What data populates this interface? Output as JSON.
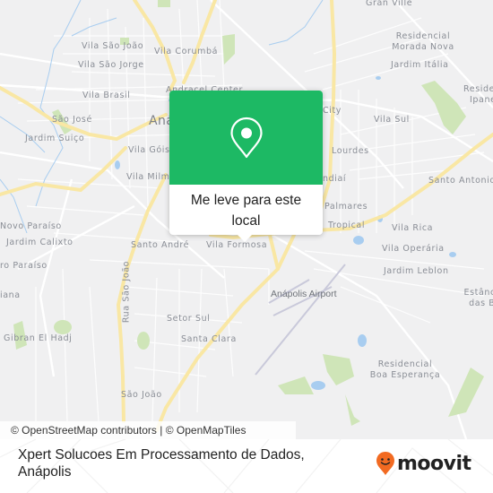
{
  "map": {
    "labels": {
      "gran_ville": "Gran Ville",
      "vila_sao_joao": "Vila São João",
      "vila_corumba": "Vila Corumbá",
      "vila_sao_jorge": "Vila São Jorge",
      "residencial_morada_nova_1": "Residencial",
      "residencial_morada_nova_2": "Morada Nova",
      "jardim_italia": "Jardim Itália",
      "residencial_ipanema_1": "Reside",
      "residencial_ipanema_2": "Ipane",
      "vila_brasil": "Vila Brasil",
      "andracel_center": "Andracel Center",
      "city": "City",
      "vila_sul": "Vila Sul",
      "sao_jose": "São José",
      "anapolis": "Aná",
      "jardim_suico": "Jardim Suiço",
      "vila_gois": "Vila Góis",
      "lourdes": "Lourdes",
      "vila_milm": "Vila Milm",
      "jundiai": "ndiaí",
      "santo_antonio": "Santo Antonio",
      "novo_paraiso": "Novo Paraíso",
      "palmares": "Palmares",
      "tropical": "Tropical",
      "vila_rica": "Vila Rica",
      "jardim_calixto": "Jardim Calixto",
      "santo_andre": "Santo André",
      "vila_formosa": "Vila Formosa",
      "vila_operaria": "Vila Operária",
      "jardim_leblon": "Jardim Leblon",
      "outro_paraiso": "ro Paraíso",
      "iana": "iana",
      "rua_sao_joao": "Rua São João",
      "anapolis_airport": "Anápolis Airport",
      "estancia_1": "Estância",
      "estancia_2": "das Br",
      "setor_sul": "Setor Sul",
      "gibran_el_hadj": "Gibran El Hadj",
      "santa_clara": "Santa Clara",
      "residencial_boa_esperanca_1": "Residencial",
      "residencial_boa_esperanca_2": "Boa Esperança",
      "sao_joao": "São João"
    },
    "attribution": "© OpenStreetMap contributors | © OpenMapTiles",
    "colors": {
      "background": "#f0f0f1",
      "road_major": "#f9e7a4",
      "road_minor": "#ffffff",
      "water": "#a8cdf0",
      "park": "#cfe5b8",
      "runway": "#c8c8d8"
    }
  },
  "popup": {
    "icon": "map-pin-icon",
    "line1": "Me leve para este",
    "line2": "local",
    "color": "#1db964"
  },
  "footer": {
    "title_line1": "Xpert Solucoes Em Processamento de Dados,",
    "title_line2": "Anápolis",
    "logo_text": "moovit",
    "logo_color": "#f26a21"
  }
}
